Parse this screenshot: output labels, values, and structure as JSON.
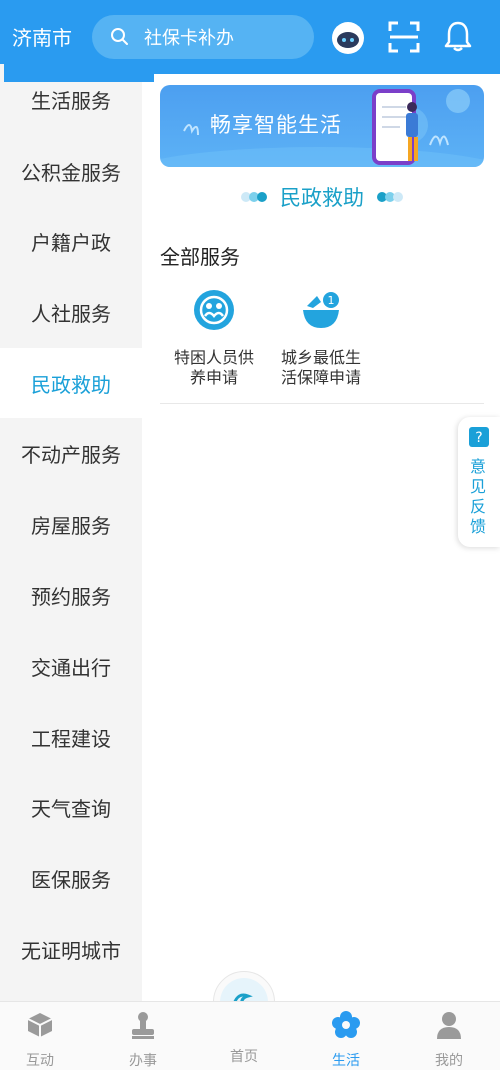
{
  "header": {
    "city": "济南市",
    "search_placeholder": "社保卡补办"
  },
  "sidebar": {
    "items": [
      {
        "label": "生活服务"
      },
      {
        "label": "公积金服务"
      },
      {
        "label": "户籍户政"
      },
      {
        "label": "人社服务"
      },
      {
        "label": "民政救助",
        "active": true
      },
      {
        "label": "不动产服务"
      },
      {
        "label": "房屋服务"
      },
      {
        "label": "预约服务"
      },
      {
        "label": "交通出行"
      },
      {
        "label": "工程建设"
      },
      {
        "label": "天气查询"
      },
      {
        "label": "医保服务"
      },
      {
        "label": "无证明城市"
      }
    ]
  },
  "banner": {
    "text": "畅享智能生活"
  },
  "section": {
    "title": "民政救助"
  },
  "services": {
    "heading": "全部服务",
    "items": [
      {
        "line1": "特困人员供",
        "line2": "养申请",
        "icon": "people-care-icon"
      },
      {
        "line1": "城乡最低生",
        "line2": "活保障申请",
        "icon": "bowl-coin-icon"
      }
    ]
  },
  "feedback": {
    "label": "意见反馈"
  },
  "bottom_nav": {
    "items": [
      {
        "label": "互动",
        "icon": "cube-icon"
      },
      {
        "label": "办事",
        "icon": "stamp-icon"
      },
      {
        "label": "首页",
        "icon": "home-logo-icon"
      },
      {
        "label": "生活",
        "icon": "flower-icon",
        "active": true
      },
      {
        "label": "我的",
        "icon": "person-icon"
      }
    ]
  },
  "colors": {
    "header_bg": "#2a9bf0",
    "accent": "#1aa0d8",
    "sidebar_bg": "#f4f4f4"
  }
}
